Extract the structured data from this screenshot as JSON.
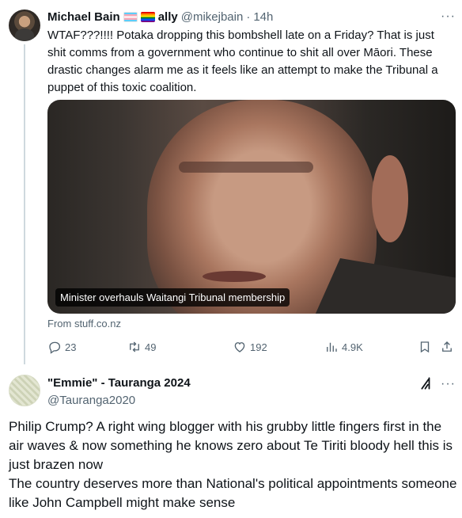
{
  "tweet1": {
    "author_name": "Michael Bain",
    "ally_label": "ally",
    "handle": "@mikejbain",
    "separator": "·",
    "time": "14h",
    "more": "···",
    "text": "WTAF???!!!! Potaka dropping this bombshell late on a Friday? That is just shit comms from a government who continue to shit all over Māori. These drastic changes alarm me as it feels like an attempt to make the Tribunal a puppet of this toxic coalition.",
    "card": {
      "caption": "Minister overhauls Waitangi Tribunal membership",
      "source": "From stuff.co.nz"
    },
    "actions": {
      "replies": "23",
      "reposts": "49",
      "likes": "192",
      "views": "4.9K"
    }
  },
  "tweet2": {
    "author_name": "\"Emmie\" - Tauranga 2024",
    "handle": "@Tauranga2020",
    "more": "···",
    "text": "Philip Crump? A right wing blogger with his grubby little fingers first in the air waves & now something he knows zero about Te Tiriti bloody hell this is just brazen now\nThe country deserves more than National's political appointments someone like John Campbell might make sense"
  },
  "icons": {
    "reply": "reply-icon",
    "repost": "repost-icon",
    "like": "heart-icon",
    "views": "views-icon",
    "bookmark": "bookmark-icon",
    "share": "share-icon",
    "grok": "grok-icon"
  },
  "colors": {
    "text": "#0f1419",
    "secondary": "#536471",
    "thread_line": "#cfd9de"
  }
}
